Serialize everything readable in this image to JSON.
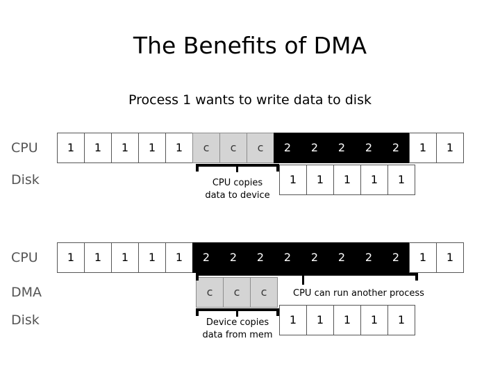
{
  "slide": {
    "title": "The Benefits of DMA",
    "subtitle": "Process 1 wants to write data to disk"
  },
  "diagram_top": {
    "rows": [
      {
        "label": "CPU",
        "cells": [
          {
            "text": "1",
            "style": "white"
          },
          {
            "text": "1",
            "style": "white"
          },
          {
            "text": "1",
            "style": "white"
          },
          {
            "text": "1",
            "style": "white"
          },
          {
            "text": "1",
            "style": "white"
          },
          {
            "text": "c",
            "style": "gray"
          },
          {
            "text": "c",
            "style": "gray"
          },
          {
            "text": "c",
            "style": "gray"
          },
          {
            "text": "2",
            "style": "black"
          },
          {
            "text": "2",
            "style": "black"
          },
          {
            "text": "2",
            "style": "black"
          },
          {
            "text": "2",
            "style": "black"
          },
          {
            "text": "2",
            "style": "black"
          },
          {
            "text": "1",
            "style": "white"
          },
          {
            "text": "1",
            "style": "white"
          }
        ]
      },
      {
        "label": "Disk",
        "cells": [
          {
            "text": "1",
            "style": "white"
          },
          {
            "text": "1",
            "style": "white"
          },
          {
            "text": "1",
            "style": "white"
          },
          {
            "text": "1",
            "style": "white"
          },
          {
            "text": "1",
            "style": "white"
          }
        ]
      }
    ],
    "annotation": {
      "line1": "CPU copies",
      "line2": "data to device"
    }
  },
  "diagram_bottom": {
    "rows": [
      {
        "label": "CPU",
        "cells": [
          {
            "text": "1",
            "style": "white"
          },
          {
            "text": "1",
            "style": "white"
          },
          {
            "text": "1",
            "style": "white"
          },
          {
            "text": "1",
            "style": "white"
          },
          {
            "text": "1",
            "style": "white"
          },
          {
            "text": "2",
            "style": "black"
          },
          {
            "text": "2",
            "style": "black"
          },
          {
            "text": "2",
            "style": "black"
          },
          {
            "text": "2",
            "style": "black"
          },
          {
            "text": "2",
            "style": "black"
          },
          {
            "text": "2",
            "style": "black"
          },
          {
            "text": "2",
            "style": "black"
          },
          {
            "text": "2",
            "style": "black"
          },
          {
            "text": "1",
            "style": "white"
          },
          {
            "text": "1",
            "style": "white"
          }
        ]
      },
      {
        "label": "DMA",
        "cells": [
          {
            "text": "c",
            "style": "gray"
          },
          {
            "text": "c",
            "style": "gray"
          },
          {
            "text": "c",
            "style": "gray"
          }
        ]
      },
      {
        "label": "Disk",
        "cells": [
          {
            "text": "1",
            "style": "white"
          },
          {
            "text": "1",
            "style": "white"
          },
          {
            "text": "1",
            "style": "white"
          },
          {
            "text": "1",
            "style": "white"
          },
          {
            "text": "1",
            "style": "white"
          }
        ]
      }
    ],
    "annotation_cpu": "CPU can run another process",
    "annotation_device": {
      "line1": "Device copies",
      "line2": "data from mem"
    }
  }
}
